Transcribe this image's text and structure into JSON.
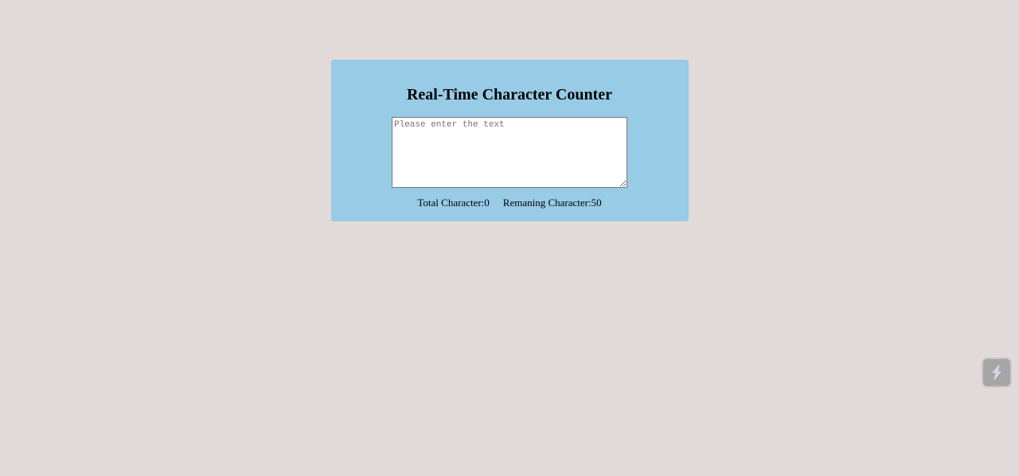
{
  "page": {
    "title": "Real-Time Character Counter"
  },
  "editor": {
    "placeholder": "Please enter the text",
    "value": ""
  },
  "counter": {
    "total_label": "Total Character:",
    "total_value": "0",
    "remaining_label": "Remaning Character:",
    "remaining_value": "50"
  },
  "floating_widget": {
    "icon": "lightning-icon"
  },
  "colors": {
    "background": "#e2dad8",
    "card": "#97cbe6",
    "widget": "#a6a6a6"
  }
}
